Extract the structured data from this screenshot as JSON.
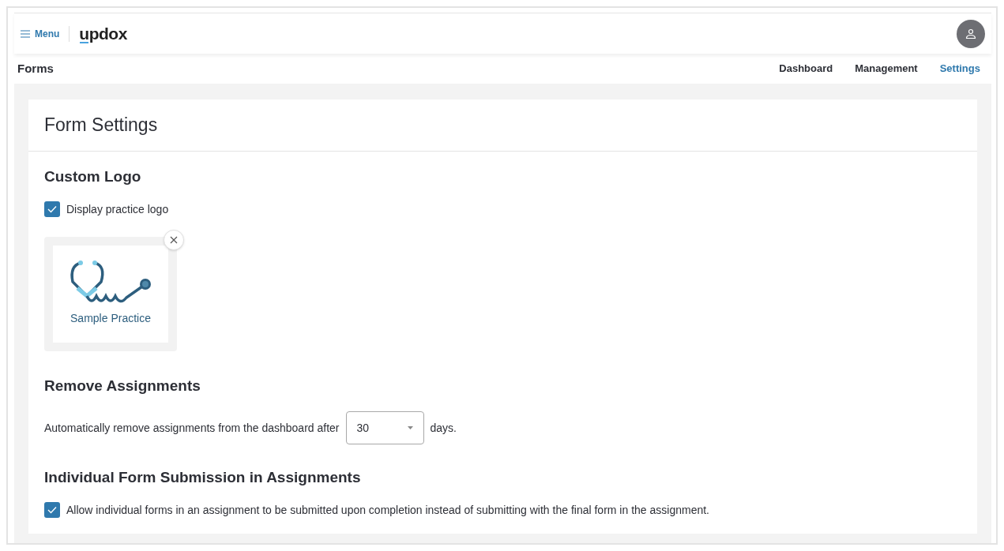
{
  "header": {
    "menu_label": "Menu",
    "logo": "updox"
  },
  "subheader": {
    "title": "Forms",
    "tabs": [
      {
        "label": "Dashboard",
        "selected": false
      },
      {
        "label": "Management",
        "selected": false
      },
      {
        "label": "Settings",
        "selected": true
      }
    ]
  },
  "card": {
    "title": "Form Settings",
    "custom_logo": {
      "heading": "Custom Logo",
      "checkbox": {
        "label": "Display practice logo",
        "checked": true
      },
      "logo_caption": "Sample Practice"
    },
    "remove_assignments": {
      "heading": "Remove Assignments",
      "text_before": "Automatically remove assignments from the dashboard after",
      "select_value": "30",
      "text_after": "days."
    },
    "individual_submission": {
      "heading": "Individual Form Submission in Assignments",
      "checkbox": {
        "label": "Allow individual forms in an assignment to be submitted upon completion instead of submitting with the final form in the assignment.",
        "checked": true
      }
    }
  }
}
